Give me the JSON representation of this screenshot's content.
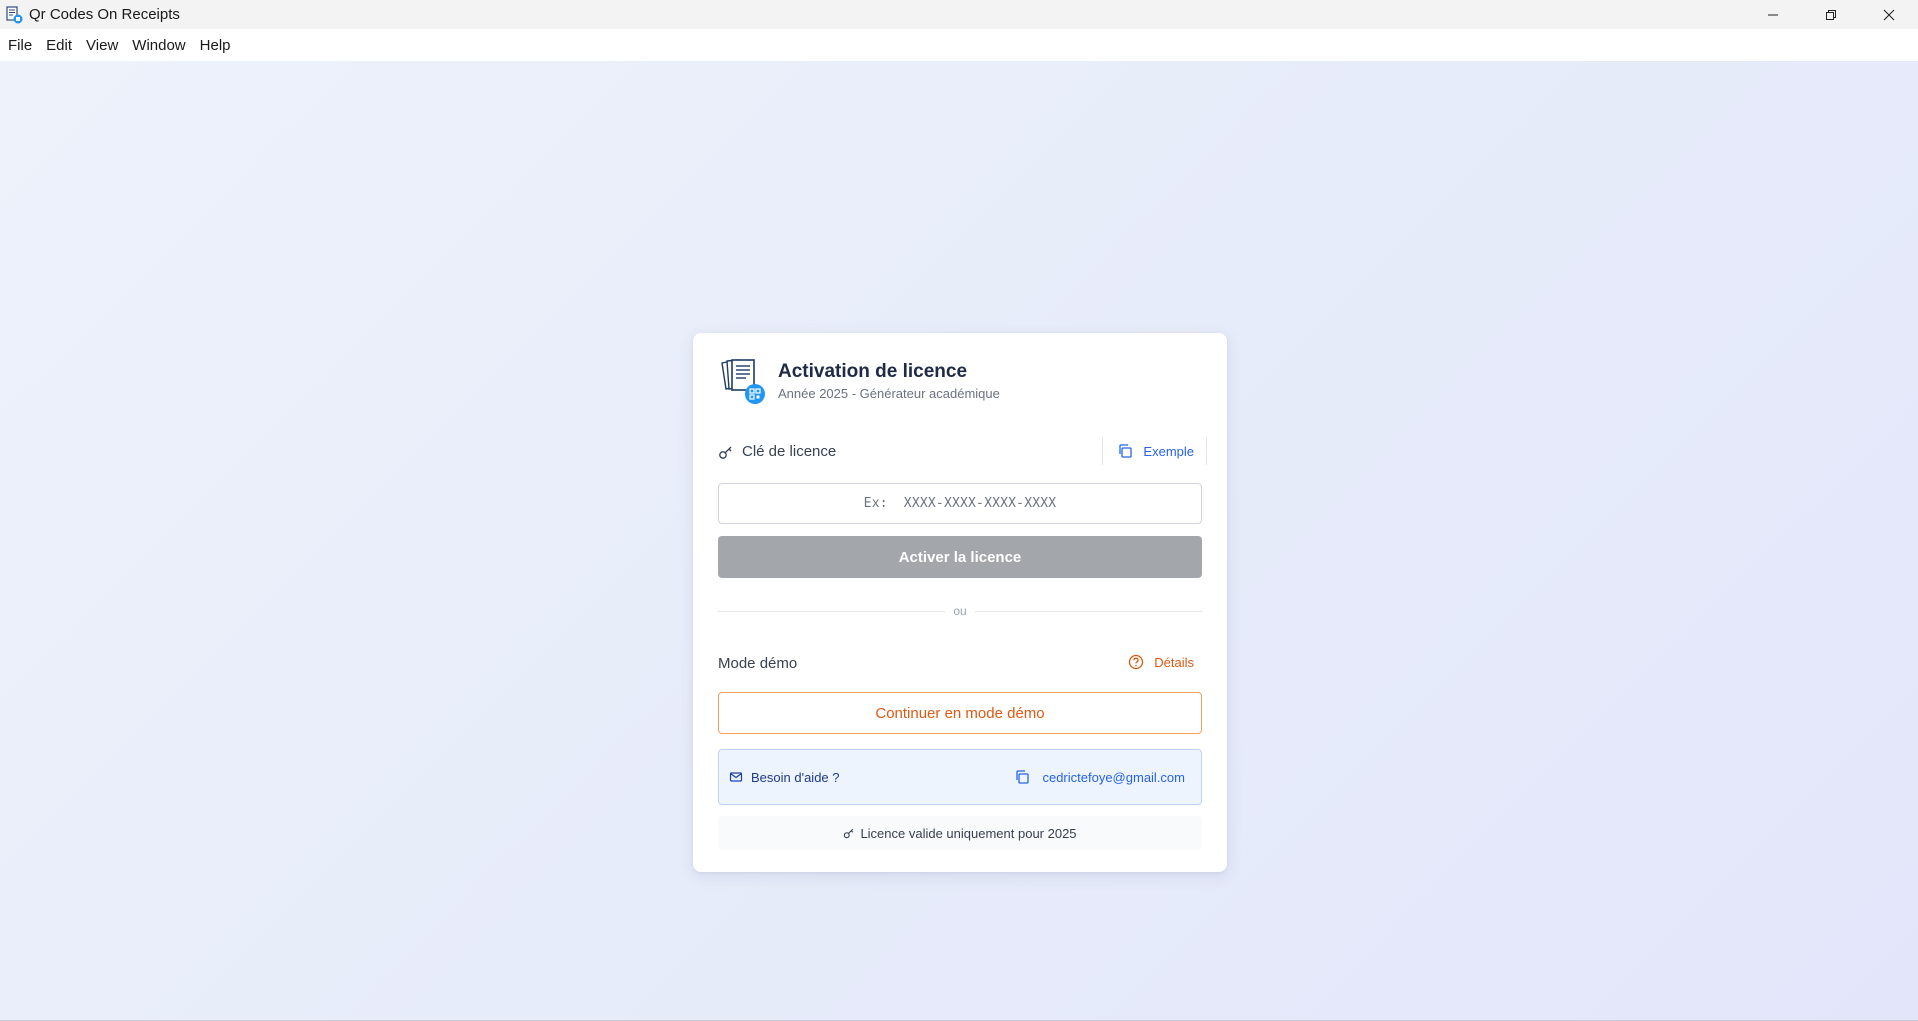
{
  "window": {
    "title": "Qr Codes On Receipts",
    "app_icon": "receipt-qr-icon",
    "controls": [
      "minimize-icon",
      "restore-icon",
      "close-icon"
    ]
  },
  "menu": {
    "items": [
      "File",
      "Edit",
      "View",
      "Window",
      "Help"
    ]
  },
  "card": {
    "title": "Activation de licence",
    "subtitle": "Année 2025 - Générateur académique",
    "license": {
      "label": "Clé de licence",
      "example_label": "Exemple",
      "input_value": "",
      "input_placeholder": "Ex:  XXXX-XXXX-XXXX-XXXX",
      "activate_label": "Activer la licence"
    },
    "divider_text": "ou",
    "demo": {
      "label": "Mode démo",
      "details_label": "Détails",
      "continue_label": "Continuer en mode démo"
    },
    "help": {
      "label": "Besoin d'aide ?",
      "email": "cedrictefoye@gmail.com"
    },
    "validity_text": "Licence valide uniquement pour 2025"
  },
  "colors": {
    "accent_blue": "#2563eb",
    "accent_orange": "#dd5a14",
    "disabled_button": "#a3a6ab",
    "background": "#e9edfa"
  }
}
